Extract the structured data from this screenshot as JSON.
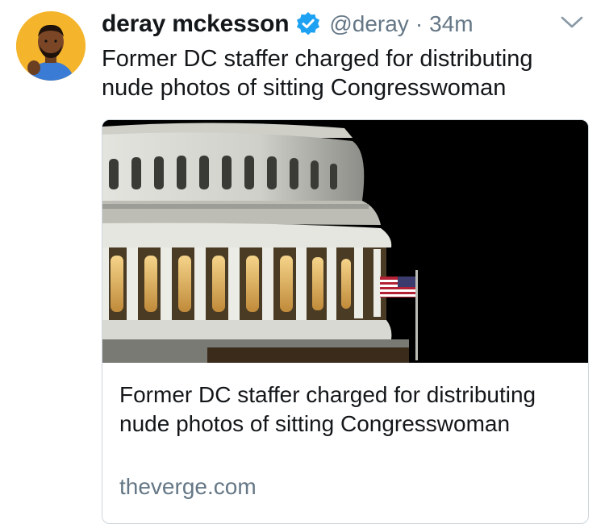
{
  "tweet": {
    "author": {
      "display_name": "deray mckesson",
      "handle": "@deray",
      "verified": true,
      "avatar_icon": "illustrated-avatar-icon"
    },
    "separator": "·",
    "timestamp": "34m",
    "text": "Former DC staffer charged for distributing nude photos of sitting Congresswoman",
    "card": {
      "image_icon": "capitol-dome-photo",
      "title": "Former DC staffer charged for distributing nude photos of sitting Congresswoman",
      "domain": "theverge.com"
    }
  },
  "colors": {
    "text_primary": "#14171a",
    "text_secondary": "#657786",
    "verified_blue": "#1da1f2",
    "avatar_background": "#f4b52c",
    "card_border": "#ccd6dd"
  }
}
